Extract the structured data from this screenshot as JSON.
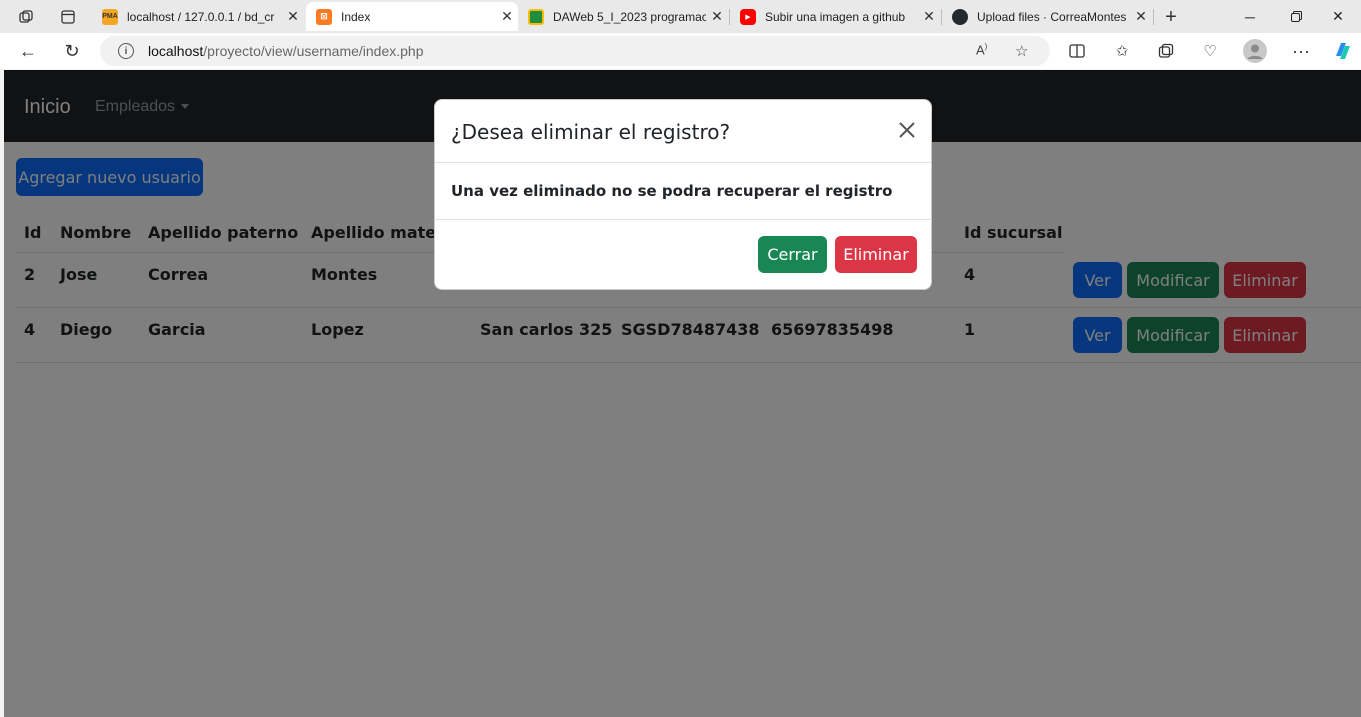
{
  "browser": {
    "tabs": [
      {
        "label": "localhost / 127.0.0.1 / bd_cr",
        "favicon": "phpmyadmin-icon"
      },
      {
        "label": "Index",
        "favicon": "xampp-icon"
      },
      {
        "label": "DAWeb 5_I_2023 programac",
        "favicon": "classroom-icon"
      },
      {
        "label": "Subir una imagen a github",
        "favicon": "youtube-icon"
      },
      {
        "label": "Upload files · CorreaMontes",
        "favicon": "github-icon"
      }
    ],
    "url_host": "localhost",
    "url_path": "/proyecto/view/username/index.php",
    "favicon_text": {
      "pma": "PMA",
      "xampp": "⊠"
    }
  },
  "navbar": {
    "brand": "Inicio",
    "dropdown": "Empleados"
  },
  "add_button": "Agregar nuevo usuario",
  "table": {
    "headers": [
      "Id",
      "Nombre",
      "Apellido paterno",
      "Apellido matern",
      "Id sucursal"
    ],
    "rows": [
      {
        "id": "2",
        "nombre": "Jose",
        "paterno": "Correa",
        "materno": "Montes",
        "direccion": "",
        "curp": "",
        "telefono": "",
        "sucursal": "4"
      },
      {
        "id": "4",
        "nombre": "Diego",
        "paterno": "Garcia",
        "materno": "Lopez",
        "direccion": "San carlos 325",
        "curp": "SGSD78487438",
        "telefono": "65697835498",
        "sucursal": "1"
      }
    ],
    "actions": {
      "view": "Ver",
      "edit": "Modificar",
      "delete": "Eliminar"
    }
  },
  "modal": {
    "title": "¿Desea eliminar el registro?",
    "body": "Una vez eliminado no se podra recuperar el registro",
    "close_button": "Cerrar",
    "confirm_button": "Eliminar"
  },
  "colors": {
    "primary": "#0d6efd",
    "success": "#198754",
    "danger": "#dc3545",
    "navbar": "#212529"
  }
}
